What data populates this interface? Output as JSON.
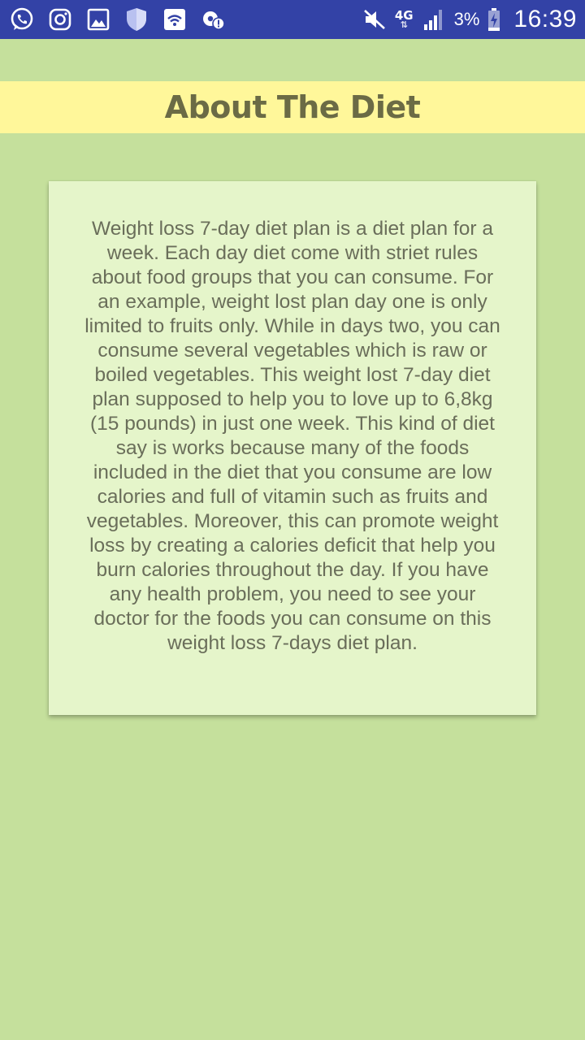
{
  "status_bar": {
    "icons": [
      "whatsapp-icon",
      "instagram-icon",
      "gallery-icon",
      "shield-icon",
      "wifi-icon",
      "settings-alert-icon"
    ],
    "network_type": "4G",
    "battery_percent": "3%",
    "time": "16:39",
    "bar_color": "#3342a6"
  },
  "header": {
    "title": "About The Diet",
    "band_color": "#fff79a"
  },
  "card": {
    "body": "Weight loss 7-day diet plan is a diet plan for a week. Each day diet come with striet rules about food groups that you can consume. For an example, weight lost plan day one is only limited to fruits only. While in days two, you can consume several vegetables which is raw or boiled vegetables. This weight lost 7-day diet plan supposed to help you to love up to 6,8kg (15 pounds) in just one week. This kind of diet say is works because many of the foods included in the diet that you consume are low calories and full of vitamin such as fruits and vegetables. Moreover, this can promote weight loss by creating a calories deficit that help you burn calories throughout the day. If you have any health problem, you need to see your doctor for the foods you can consume on this weight loss 7-days diet plan.",
    "background_color": "#e5f5ca"
  },
  "page": {
    "background_color": "#c5e09c"
  }
}
